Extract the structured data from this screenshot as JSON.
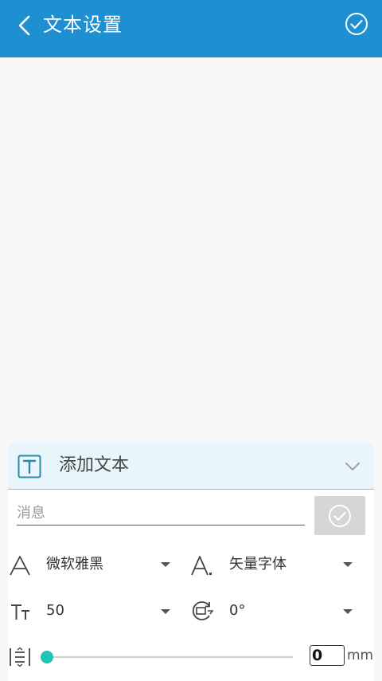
{
  "header": {
    "title": "文本设置",
    "back_icon": "chevron-left",
    "confirm_icon": "check-circle",
    "color": "#1e8fd0"
  },
  "panel": {
    "title": "添加文本",
    "title_icon": "text-box",
    "collapse_icon": "chevron-down",
    "message_input": {
      "value": "",
      "placeholder": "消息"
    },
    "submit_icon": "check-circle",
    "font_family": {
      "icon": "font-letter-a",
      "selected": "微软雅黑"
    },
    "font_type": {
      "icon": "vector-font",
      "selected": "矢量字体"
    },
    "font_size": {
      "icon": "text-size",
      "selected": "50"
    },
    "rotation": {
      "icon": "rotate",
      "selected": "0°"
    },
    "spacing": {
      "icon": "line-spacing",
      "slider_value": 0,
      "value": "0",
      "unit": "mm",
      "accent": "#20c4b4"
    }
  }
}
